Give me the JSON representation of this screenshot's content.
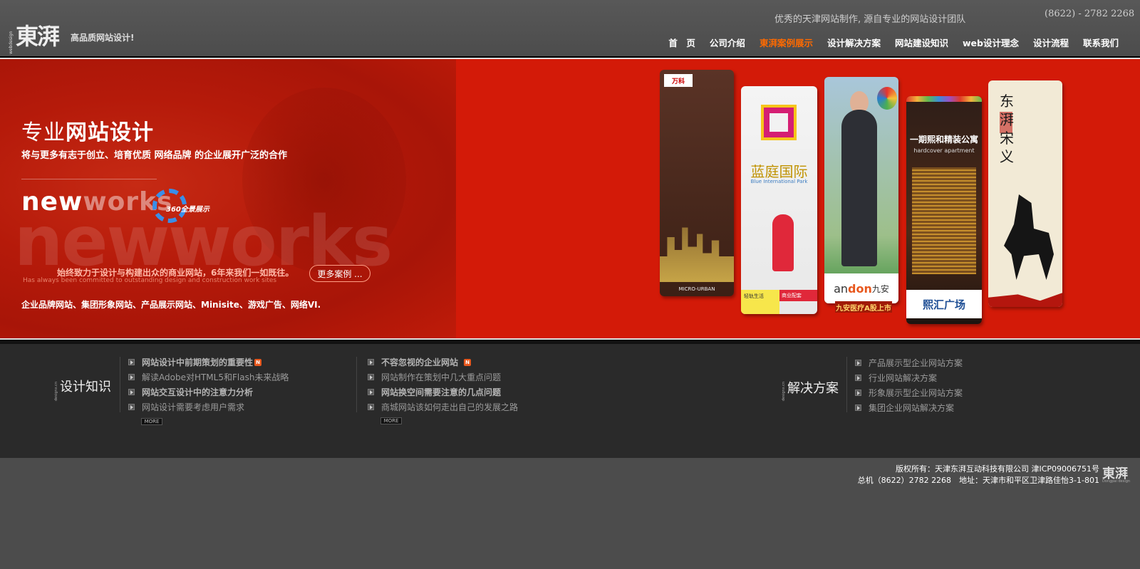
{
  "header": {
    "logo_main": "東湃",
    "logo_side": "webdesign",
    "logo_tagline": "高品质网站设计!",
    "slogan": "优秀的天津网站制作, 源自专业的网站设计团队",
    "phone": "(8622) - 2782 2268",
    "nav": [
      {
        "label": "首　页",
        "active": false
      },
      {
        "label": "公司介绍",
        "active": false
      },
      {
        "label": "東湃案例展示",
        "active": true
      },
      {
        "label": "设计解决方案",
        "active": false
      },
      {
        "label": "网站建设知识",
        "active": false
      },
      {
        "label": "web设计理念",
        "active": false
      },
      {
        "label": "设计流程",
        "active": false
      },
      {
        "label": "联系我们",
        "active": false
      }
    ]
  },
  "banner": {
    "title_light": "专业",
    "title_bold": "网站设计",
    "subtitle": "将与更多有志于创立、培育优质 网络品牌 的企业展开广泛的合作",
    "newworks_a": "new",
    "newworks_b": "works",
    "badge_360": "360全景展示",
    "ghost_text": "newworks",
    "committed": "始终致力于设计与构建出众的商业网站，6年来我们一如既往。",
    "committed_en": "Has always been committed to outstanding design and construction work sites",
    "more_label": "更多案例 ...",
    "categories": "企业品牌网站、集团形象网站、产品展示网站、Minisite、游戏广告、网络VI."
  },
  "cases": [
    {
      "brand": "万科",
      "caption": "MICRO-URBAN"
    },
    {
      "name": "蓝庭国际",
      "name_en": "Blue International Park",
      "foot_left": "轻轨生活",
      "foot_right": "商业配套"
    },
    {
      "brand_a": "an",
      "brand_b": "don",
      "brand_c": "九安",
      "tag": "九安医疗A股上市"
    },
    {
      "title": "一期熙和精装公寓",
      "subtitle": "hardcover apartment",
      "foot": "熙汇广场"
    },
    {
      "calligraphy": "东湃宋义"
    }
  ],
  "knowledge": {
    "title": "设计知识",
    "side": "designx.cn",
    "col1": [
      {
        "text": "网站设计中前期策划的重要性",
        "bold": true,
        "badge": "N"
      },
      {
        "text": "解读Adobe对HTML5和Flash未来战略",
        "bold": false
      },
      {
        "text": "网站交互设计中的注意力分析",
        "bold": true
      },
      {
        "text": "网站设计需要考虑用户需求",
        "bold": false
      }
    ],
    "col2": [
      {
        "text": "不容忽视的企业网站",
        "bold": true,
        "badge": "N"
      },
      {
        "text": "网站制作在策划中几大重点问题",
        "bold": false
      },
      {
        "text": "网站换空间需要注意的几点问题",
        "bold": true
      },
      {
        "text": "商城网站该如何走出自己的发展之路",
        "bold": false
      }
    ],
    "more": "MORE"
  },
  "solutions": {
    "title": "解决方案",
    "side": "designx.cn",
    "items": [
      "产品展示型企业网站方案",
      "行业网站解决方案",
      "形象展示型企业网站方案",
      "集团企业网站解决方案"
    ]
  },
  "footer": {
    "line1": "版权所有：天津东湃互动科技有限公司 津ICP09006751号",
    "line2": "总机（8622）2782 2268　地址：天津市和平区卫津路佳怡3-1-801",
    "logo": "東湃",
    "logo_sub": "Dongpai design"
  }
}
